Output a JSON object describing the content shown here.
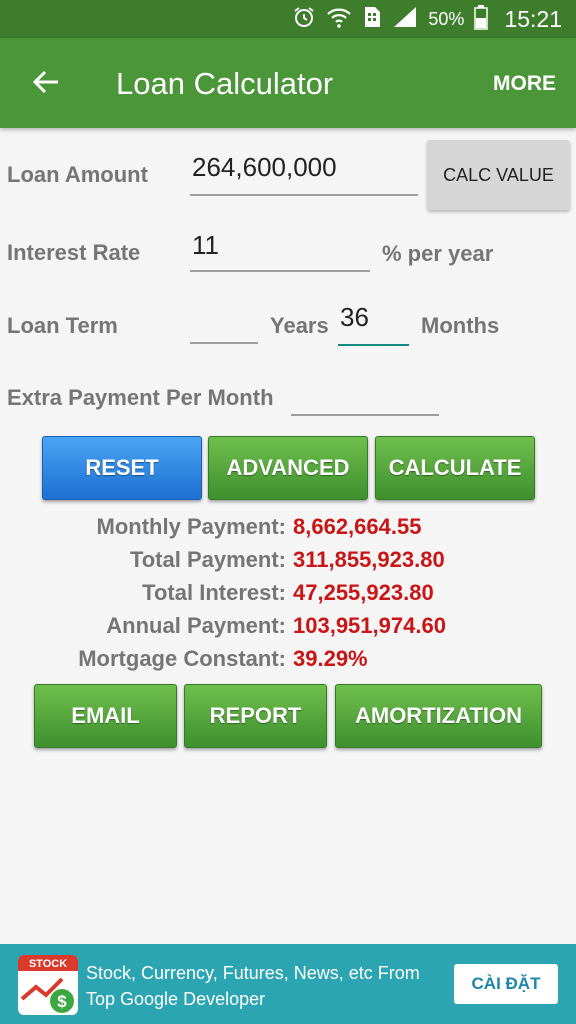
{
  "status_bar": {
    "battery": "50%",
    "time": "15:21",
    "icons": [
      "alarm-icon",
      "wifi-icon",
      "sim-icon",
      "signal-icon",
      "battery-icon"
    ]
  },
  "app_bar": {
    "title": "Loan Calculator",
    "more_label": "MORE",
    "back_icon": "back-arrow-icon"
  },
  "form": {
    "loan_amount": {
      "label": "Loan Amount",
      "value": "264,600,000"
    },
    "calc_value_label": "CALC VALUE",
    "interest_rate": {
      "label": "Interest Rate",
      "value": "11",
      "unit": "% per year"
    },
    "loan_term": {
      "label": "Loan Term",
      "years_value": "",
      "years_label": "Years",
      "months_value": "36",
      "months_label": "Months"
    },
    "extra_payment": {
      "label": "Extra Payment Per Month",
      "value": ""
    }
  },
  "action_buttons": {
    "reset": "RESET",
    "advanced": "ADVANCED",
    "calculate": "CALCULATE"
  },
  "results": [
    {
      "label": "Monthly Payment:",
      "value": "8,662,664.55"
    },
    {
      "label": "Total Payment:",
      "value": "311,855,923.80"
    },
    {
      "label": "Total Interest:",
      "value": "47,255,923.80"
    },
    {
      "label": "Annual Payment:",
      "value": "103,951,974.60"
    },
    {
      "label": "Mortgage Constant:",
      "value": "39.29%"
    }
  ],
  "share_buttons": {
    "email": "EMAIL",
    "report": "REPORT",
    "amortization": "AMORTIZATION"
  },
  "ad": {
    "icon_text": "STOCK",
    "text": "Stock, Currency, Futures, News, etc From Top Google Developer",
    "install_label": "CÀI ĐẶT"
  },
  "colors": {
    "status_bar": "#3d7d2c",
    "app_bar": "#4c963a",
    "result_value": "#c91515",
    "ad_background": "#2aa5b1"
  }
}
